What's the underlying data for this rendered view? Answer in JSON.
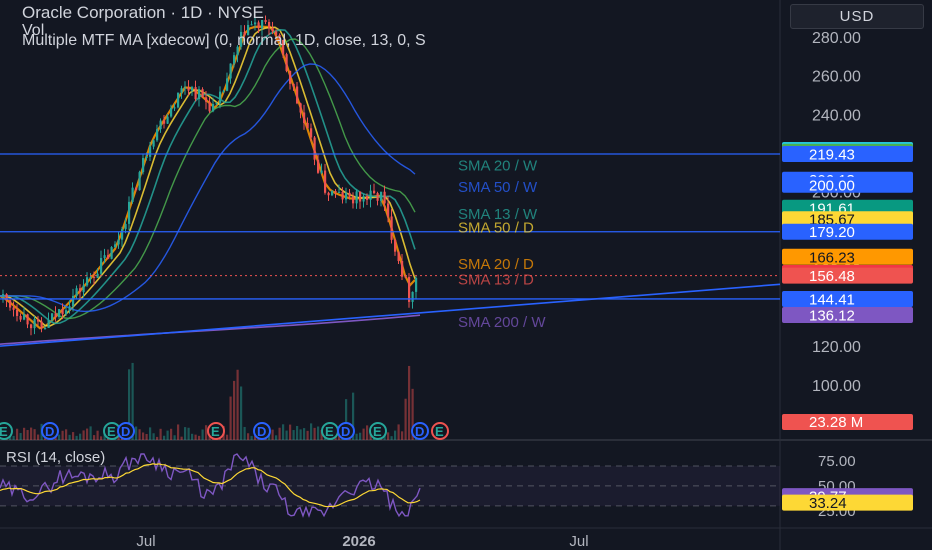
{
  "header": {
    "title": "Oracle Corporation · 1D · NYSE",
    "vol_label": "Vol",
    "indicator": "Multiple MTF MA [xdecow] (0, normal, 1D, close, 13, 0, S"
  },
  "currency_button": "USD",
  "rsi_label": "RSI (14, close)",
  "colors": {
    "background": "#131722",
    "hline": "#2962ff",
    "up": "#26a69a",
    "down": "#ef5350",
    "rsi": "#7e57c2",
    "rsi_ma": "#fdd835"
  },
  "chart_data": {
    "type": "candlestick",
    "price_ticks": [
      "280.00",
      "260.00",
      "240.00",
      "220.00",
      "200.00",
      "180.00",
      "160.00",
      "140.00",
      "120.00",
      "100.00",
      "80.00"
    ],
    "x_ticks": [
      "Jul",
      "2026",
      "Jul"
    ],
    "ma_labels": [
      {
        "text": "SMA 20 / W",
        "price": 214,
        "color": "#26a69a"
      },
      {
        "text": "SMA 50 / W",
        "price": 203,
        "color": "#2962ff"
      },
      {
        "text": "SMA 13 / W",
        "price": 189,
        "color": "#26a69a"
      },
      {
        "text": "SMA 50 / D",
        "price": 182,
        "color": "#fdd835"
      },
      {
        "text": "SMA 20 / D",
        "price": 163,
        "color": "#ff9800"
      },
      {
        "text": "SMA 13 / D",
        "price": 155,
        "color": "#ef5350"
      },
      {
        "text": "SMA 200 / W",
        "price": 133,
        "color": "#7e57c2"
      }
    ],
    "price_tags": [
      {
        "text": "221.50",
        "price": 221.5,
        "bg": "#26c6da",
        "fg": "#131722"
      },
      {
        "text": "220.51",
        "price": 220.51,
        "bg": "#4caf50",
        "fg": "#131722"
      },
      {
        "text": "219.43",
        "price": 219.43,
        "bg": "#2962ff",
        "fg": "#ffffff"
      },
      {
        "text": "206.13",
        "price": 206.13,
        "bg": "#2962ff",
        "fg": "#ffffff"
      },
      {
        "text": "200.00",
        "price": 203.5,
        "bg": "#2962ff",
        "fg": "#ffffff"
      },
      {
        "text": "191.61",
        "price": 191.61,
        "bg": "#089981",
        "fg": "#ffffff"
      },
      {
        "text": "185.67",
        "price": 185.67,
        "bg": "#fdd835",
        "fg": "#131722"
      },
      {
        "text": "179.20",
        "price": 179.2,
        "bg": "#2962ff",
        "fg": "#ffffff"
      },
      {
        "text": "166.23",
        "price": 166.23,
        "bg": "#ff9800",
        "fg": "#131722"
      },
      {
        "text": "157.85",
        "price": 157.85,
        "bg": "#f23645",
        "fg": "#ffffff"
      },
      {
        "text": "156.48",
        "price": 156.48,
        "bg": "#ef5350",
        "fg": "#ffffff"
      },
      {
        "text": "144.41",
        "price": 144.41,
        "bg": "#2962ff",
        "fg": "#ffffff"
      },
      {
        "text": "136.12",
        "price": 136.12,
        "bg": "#7e57c2",
        "fg": "#ffffff"
      }
    ],
    "volume_tag": {
      "text": "23.28 M",
      "bg": "#ef5350",
      "fg": "#ffffff"
    },
    "horizontal_levels": [
      219.43,
      179.2,
      144.41
    ],
    "trendline": {
      "from": [
        0,
        120
      ],
      "to": [
        1,
        152
      ]
    },
    "rsi_ticks": [
      "75.00",
      "50.00",
      "25.00"
    ],
    "rsi_tags": [
      {
        "text": "39.77",
        "value": 39.77,
        "bg": "#7e57c2",
        "fg": "#ffffff"
      },
      {
        "text": "33.24",
        "value": 33.24,
        "bg": "#fdd835",
        "fg": "#131722"
      }
    ],
    "earnings_markers": [
      "E",
      "D",
      "E",
      "D",
      "E",
      "D",
      "E",
      "D",
      "E",
      "D",
      "E"
    ]
  }
}
